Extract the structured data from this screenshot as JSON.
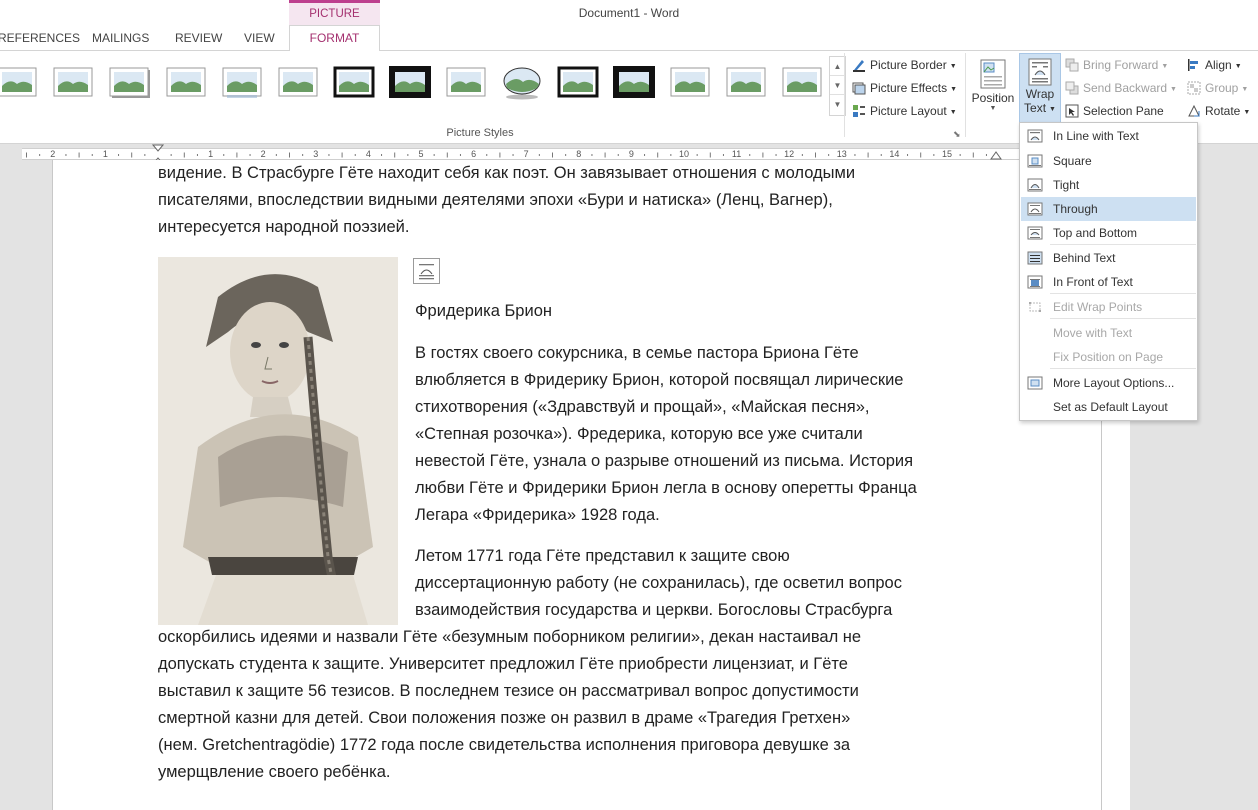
{
  "window": {
    "title": "Document1 - Word"
  },
  "contextual_tab": {
    "label": "PICTURE TOOLS",
    "accent": "#bd3f8e"
  },
  "tabs": [
    {
      "label": "REFERENCES"
    },
    {
      "label": "MAILINGS"
    },
    {
      "label": "REVIEW"
    },
    {
      "label": "VIEW"
    },
    {
      "label": "FORMAT"
    }
  ],
  "ribbon": {
    "picture_styles_label": "Picture Styles",
    "picture_border": "Picture Border",
    "picture_effects": "Picture Effects",
    "picture_layout": "Picture Layout",
    "position": "Position",
    "wrap_line1": "Wrap",
    "wrap_line2": "Text",
    "bring_forward": "Bring Forward",
    "send_backward": "Send Backward",
    "selection_pane": "Selection Pane",
    "align": "Align",
    "group": "Group",
    "rotate": "Rotate"
  },
  "ruler": {
    "numbers": [
      "2",
      "1",
      "",
      "1",
      "2",
      "3",
      "4",
      "5",
      "6",
      "7",
      "8",
      "9",
      "10",
      "11",
      "12",
      "13",
      "14",
      "15"
    ]
  },
  "wrap_menu": {
    "items": [
      {
        "label": "In Line with Text",
        "icon": "inline-icon"
      },
      {
        "label": "Square",
        "icon": "square-wrap-icon"
      },
      {
        "label": "Tight",
        "icon": "tight-wrap-icon"
      },
      {
        "label": "Through",
        "icon": "through-wrap-icon"
      },
      {
        "label": "Top and Bottom",
        "icon": "top-bottom-wrap-icon"
      },
      {
        "label": "Behind Text",
        "icon": "behind-text-icon"
      },
      {
        "label": "In Front of Text",
        "icon": "front-text-icon"
      },
      {
        "label": "Edit Wrap Points",
        "icon": "edit-wrap-points-icon"
      },
      {
        "label": "Move with Text"
      },
      {
        "label": "Fix Position on Page"
      },
      {
        "label": "More Layout Options...",
        "icon": "layout-options-icon"
      },
      {
        "label": "Set as Default Layout"
      }
    ]
  },
  "document": {
    "lines_top": [
      "видение. В Страсбурге Гёте находит себя как поэт. Он завязывает отношения с молодыми",
      "писателями, впоследствии видными деятелями эпохи «Бури и натиска» (Ленц, Вагнер),",
      "интересуется народной поэзией."
    ],
    "caption": "Фридерика Брион",
    "para2_lines": [
      "В гостях своего сокурсника, в семье пастора Бриона Гёте",
      "влюбляется в Фридерику Брион, которой посвящал лирические",
      "стихотворения («Здравствуй и прощай», «Майская песня»,",
      "«Степная розочка»). Фредерика, которую все уже считали",
      "невестой Гёте, узнала о разрыве отношений из письма. История",
      "любви Гёте и Фридерики Брион легла в основу оперетты Франца",
      "Легара «Фридерика» 1928 года."
    ],
    "para3_lines_right": [
      "Летом 1771 года Гёте представил к защите свою",
      "диссертационную работу (не сохранилась), где осветил вопрос",
      "взаимодействия государства и церкви. Богословы Страсбурга"
    ],
    "para3_lines_full": [
      "оскорбились идеями и назвали Гёте «безумным поборником религии», декан настаивал не",
      "допускать студента к защите. Университет предложил Гёте приобрести лицензиат, и Гёте",
      "выставил к защите 56 тезисов. В последнем тезисе он рассматривал вопрос допустимости",
      "смертной казни для детей. Свои положения позже он развил в драме «Трагедия Гретхен»",
      "(нем. Gretchentragödie) 1772 года после свидетельства исполнения приговора девушке за",
      "умерщвление своего ребёнка."
    ]
  }
}
